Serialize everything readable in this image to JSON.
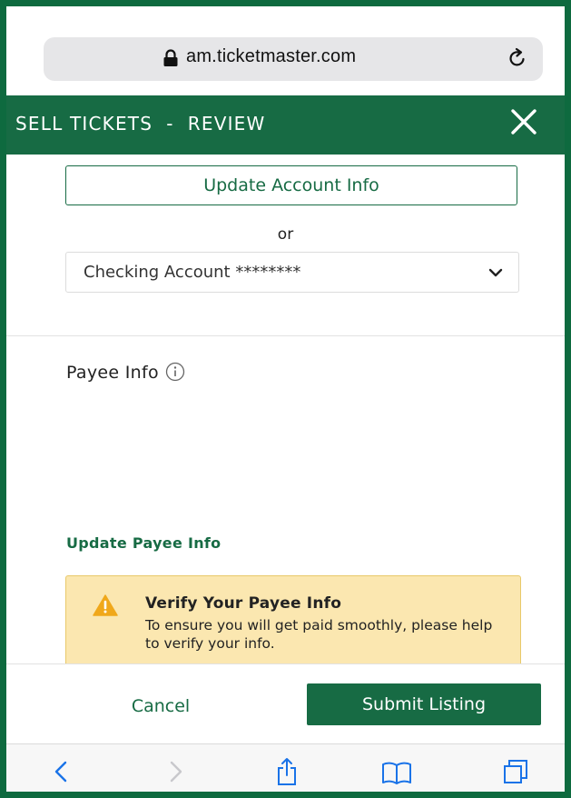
{
  "browser": {
    "url": "am.ticketmaster.com",
    "lock_icon": "lock-icon",
    "reload_icon": "reload-icon"
  },
  "header": {
    "title": "SELL TICKETS  -  REVIEW",
    "close_icon": "close-icon",
    "bg_color": "#176b44"
  },
  "payment": {
    "update_account_label": "Update Account Info",
    "or_label": "or",
    "account_select_value": "Checking Account ********"
  },
  "payee": {
    "title": "Payee Info",
    "update_link": "Update Payee Info"
  },
  "alert": {
    "title": "Verify Your Payee Info",
    "body": "To ensure you will get paid smoothly, please help to verify your info.",
    "bg_color": "#fbe7b0"
  },
  "actions": {
    "cancel_label": "Cancel",
    "submit_label": "Submit Listing"
  },
  "toolbar": {
    "icons": [
      "back-icon",
      "forward-icon",
      "share-icon",
      "bookmarks-icon",
      "tabs-icon"
    ]
  }
}
